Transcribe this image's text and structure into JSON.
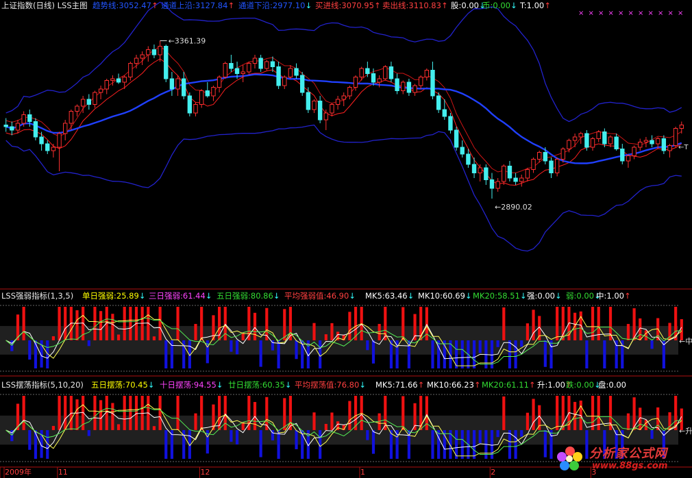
{
  "main_header": {
    "title": "上证指数(日线) LSS主图",
    "items": [
      {
        "label": "趋势线:",
        "value": "3052.47",
        "arrow": "↑",
        "color": "#2255ff"
      },
      {
        "label": "通道上沿:",
        "value": "3127.84",
        "arrow": "↑",
        "color": "#2255ff"
      },
      {
        "label": "通道下沿:",
        "value": "2977.10",
        "arrow": "↓",
        "color": "#2255ff"
      },
      {
        "label": "买进线:",
        "value": "3070.95",
        "arrow": "↑",
        "color": "#ff4040"
      },
      {
        "label": "卖出线:",
        "value": "3110.83",
        "arrow": "↑",
        "color": "#ff4040"
      },
      {
        "label": "股:",
        "value": "0.00",
        "arrow": "↓",
        "color": "#ffffff"
      },
      {
        "label": "币:",
        "value": "0.00",
        "arrow": "↓",
        "color": "#33dd33"
      },
      {
        "label": "T:",
        "value": "1.00",
        "arrow": "↑",
        "color": "#ffffff"
      }
    ],
    "high_label": "3361.39",
    "low_label": "2890.02",
    "t_marker": "T"
  },
  "strength_header": {
    "title": "LSS强弱指标(1,3,5)",
    "items": [
      {
        "label": "单日强弱:",
        "value": "25.89",
        "arrow": "↓",
        "color": "#ffff00"
      },
      {
        "label": "三日强弱:",
        "value": "61.44",
        "arrow": "↓",
        "color": "#ff44ff"
      },
      {
        "label": "五日强弱:",
        "value": "80.86",
        "arrow": "↓",
        "color": "#33dd33"
      },
      {
        "label": "平均强弱值:",
        "value": "46.90",
        "arrow": "↓",
        "color": "#ff4040"
      },
      {
        "label": "MK5:",
        "value": "63.46",
        "arrow": "↓",
        "color": "#ffffff"
      },
      {
        "label": "MK10:",
        "value": "60.69",
        "arrow": "↓",
        "color": "#ffffff"
      },
      {
        "label": "MK20:",
        "value": "58.51",
        "arrow": "↓",
        "color": "#33dd33"
      },
      {
        "label": "强:",
        "value": "0.00",
        "arrow": "↓",
        "color": "#ffffff"
      },
      {
        "label": "弱:",
        "value": "0.00",
        "arrow": "↓",
        "color": "#33dd33"
      },
      {
        "label": "中:",
        "value": "1.00",
        "arrow": "↑",
        "color": "#ffffff"
      }
    ],
    "marker": "中"
  },
  "swing_header": {
    "title": "LSS摆荡指标(5,10,20)",
    "items": [
      {
        "label": "五日摆荡:",
        "value": "70.45",
        "arrow": "↓",
        "color": "#ffff00"
      },
      {
        "label": "十日摆荡:",
        "value": "94.55",
        "arrow": "↓",
        "color": "#ff44ff"
      },
      {
        "label": "廿日摆荡:",
        "value": "60.35",
        "arrow": "↓",
        "color": "#33dd33"
      },
      {
        "label": "平均摆荡值:",
        "value": "76.80",
        "arrow": "↓",
        "color": "#ff4040"
      },
      {
        "label": "MK5:",
        "value": "71.66",
        "arrow": "↑",
        "color": "#ffffff"
      },
      {
        "label": "MK10:",
        "value": "66.23",
        "arrow": "↑",
        "color": "#ffffff"
      },
      {
        "label": "MK20:",
        "value": "61.11",
        "arrow": "↑",
        "color": "#33dd33"
      },
      {
        "label": "升:",
        "value": "1.00",
        "arrow": "↑",
        "color": "#ffffff"
      },
      {
        "label": "跌:",
        "value": "0.00",
        "arrow": "↓",
        "color": "#33dd33"
      },
      {
        "label": "盘:",
        "value": "0.00",
        "arrow": "",
        "color": "#ffffff"
      }
    ],
    "marker": "升"
  },
  "x_axis": {
    "labels": [
      {
        "text": "2009年",
        "bar": 0
      },
      {
        "text": "11",
        "bar": 9
      },
      {
        "text": "12",
        "bar": 33
      },
      {
        "text": "1",
        "bar": 60
      },
      {
        "text": "2",
        "bar": 82
      },
      {
        "text": "3",
        "bar": 99
      }
    ]
  },
  "watermark": {
    "cn": "分析家公式网",
    "url": "www.88gs.com"
  },
  "colors": {
    "up": "#ff3030",
    "down": "#44eeee",
    "trend": "#2040ff",
    "channel": "#2222cc",
    "buy": "#ff2020",
    "sell": "#cc1515",
    "frame": "#b01010",
    "bar_up": "#ee1111",
    "bar_dn": "#1111dd",
    "band": "#202020"
  },
  "chart_data": {
    "type": "candlestick",
    "ylim": [
      2820,
      3420
    ],
    "ohlc": [
      [
        3115,
        3135,
        3095,
        3110
      ],
      [
        3110,
        3125,
        3085,
        3100
      ],
      [
        3100,
        3130,
        3090,
        3120
      ],
      [
        3120,
        3155,
        3110,
        3145
      ],
      [
        3145,
        3160,
        3110,
        3125
      ],
      [
        3125,
        3135,
        3070,
        3080
      ],
      [
        3080,
        3095,
        3040,
        3060
      ],
      [
        3060,
        3070,
        3030,
        3040
      ],
      [
        3040,
        3060,
        3020,
        3050
      ],
      [
        3050,
        3095,
        2980,
        3090
      ],
      [
        3090,
        3130,
        3070,
        3120
      ],
      [
        3120,
        3160,
        3100,
        3155
      ],
      [
        3155,
        3175,
        3140,
        3170
      ],
      [
        3170,
        3200,
        3150,
        3190
      ],
      [
        3190,
        3205,
        3160,
        3175
      ],
      [
        3175,
        3215,
        3165,
        3210
      ],
      [
        3210,
        3230,
        3190,
        3220
      ],
      [
        3220,
        3250,
        3205,
        3245
      ],
      [
        3245,
        3260,
        3230,
        3250
      ],
      [
        3250,
        3265,
        3235,
        3240
      ],
      [
        3240,
        3260,
        3220,
        3255
      ],
      [
        3255,
        3300,
        3245,
        3295
      ],
      [
        3295,
        3320,
        3280,
        3310
      ],
      [
        3310,
        3330,
        3290,
        3320
      ],
      [
        3320,
        3345,
        3300,
        3335
      ],
      [
        3335,
        3350,
        3310,
        3320
      ],
      [
        3320,
        3361,
        3300,
        3345
      ],
      [
        3345,
        3350,
        3240,
        3250
      ],
      [
        3250,
        3270,
        3200,
        3220
      ],
      [
        3220,
        3260,
        3200,
        3250
      ],
      [
        3250,
        3270,
        3190,
        3200
      ],
      [
        3200,
        3210,
        3140,
        3150
      ],
      [
        3150,
        3180,
        3140,
        3175
      ],
      [
        3175,
        3220,
        3165,
        3215
      ],
      [
        3215,
        3240,
        3195,
        3200
      ],
      [
        3200,
        3230,
        3185,
        3225
      ],
      [
        3225,
        3260,
        3210,
        3255
      ],
      [
        3255,
        3300,
        3250,
        3295
      ],
      [
        3295,
        3320,
        3270,
        3280
      ],
      [
        3280,
        3300,
        3250,
        3265
      ],
      [
        3265,
        3290,
        3240,
        3270
      ],
      [
        3270,
        3300,
        3265,
        3295
      ],
      [
        3295,
        3320,
        3280,
        3310
      ],
      [
        3310,
        3320,
        3270,
        3280
      ],
      [
        3280,
        3305,
        3275,
        3300
      ],
      [
        3300,
        3315,
        3270,
        3285
      ],
      [
        3285,
        3300,
        3220,
        3230
      ],
      [
        3230,
        3260,
        3220,
        3255
      ],
      [
        3255,
        3290,
        3250,
        3280
      ],
      [
        3280,
        3295,
        3250,
        3260
      ],
      [
        3260,
        3270,
        3200,
        3210
      ],
      [
        3210,
        3225,
        3150,
        3160
      ],
      [
        3160,
        3190,
        3150,
        3185
      ],
      [
        3185,
        3200,
        3120,
        3130
      ],
      [
        3130,
        3160,
        3100,
        3150
      ],
      [
        3150,
        3180,
        3140,
        3175
      ],
      [
        3175,
        3200,
        3160,
        3190
      ],
      [
        3190,
        3210,
        3170,
        3200
      ],
      [
        3200,
        3230,
        3190,
        3225
      ],
      [
        3225,
        3260,
        3215,
        3255
      ],
      [
        3255,
        3285,
        3245,
        3280
      ],
      [
        3280,
        3300,
        3255,
        3265
      ],
      [
        3265,
        3280,
        3230,
        3240
      ],
      [
        3240,
        3260,
        3225,
        3250
      ],
      [
        3250,
        3290,
        3245,
        3285
      ],
      [
        3285,
        3300,
        3240,
        3250
      ],
      [
        3250,
        3265,
        3205,
        3215
      ],
      [
        3215,
        3245,
        3205,
        3240
      ],
      [
        3240,
        3250,
        3200,
        3210
      ],
      [
        3210,
        3235,
        3200,
        3230
      ],
      [
        3230,
        3260,
        3220,
        3255
      ],
      [
        3255,
        3280,
        3245,
        3275
      ],
      [
        3275,
        3300,
        3190,
        3200
      ],
      [
        3200,
        3210,
        3150,
        3160
      ],
      [
        3160,
        3190,
        3130,
        3140
      ],
      [
        3140,
        3150,
        3090,
        3100
      ],
      [
        3100,
        3110,
        3040,
        3050
      ],
      [
        3050,
        3070,
        3020,
        3030
      ],
      [
        3030,
        3045,
        2990,
        3000
      ],
      [
        3000,
        3020,
        2960,
        2975
      ],
      [
        2975,
        3000,
        2950,
        2990
      ],
      [
        2990,
        3000,
        2940,
        2955
      ],
      [
        2955,
        2975,
        2900,
        2930
      ],
      [
        2930,
        2960,
        2920,
        2950
      ],
      [
        2950,
        3000,
        2940,
        2995
      ],
      [
        2995,
        3010,
        2950,
        2960
      ],
      [
        2960,
        2975,
        2940,
        2950
      ],
      [
        2950,
        2970,
        2935,
        2960
      ],
      [
        2960,
        2990,
        2950,
        2985
      ],
      [
        2985,
        3020,
        2975,
        3015
      ],
      [
        3015,
        3040,
        3005,
        3035
      ],
      [
        3035,
        3050,
        3000,
        3010
      ],
      [
        3010,
        3020,
        2960,
        2975
      ],
      [
        2975,
        3020,
        2965,
        3015
      ],
      [
        3015,
        3050,
        3005,
        3045
      ],
      [
        3045,
        3075,
        3035,
        3070
      ],
      [
        3070,
        3090,
        3050,
        3080
      ],
      [
        3080,
        3095,
        3060,
        3090
      ],
      [
        3090,
        3100,
        3040,
        3050
      ],
      [
        3050,
        3080,
        3040,
        3075
      ],
      [
        3075,
        3100,
        3065,
        3095
      ],
      [
        3095,
        3105,
        3050,
        3060
      ],
      [
        3060,
        3085,
        3050,
        3080
      ],
      [
        3080,
        3090,
        3040,
        3045
      ],
      [
        3045,
        3060,
        3000,
        3010
      ],
      [
        3010,
        3030,
        2990,
        3025
      ],
      [
        3025,
        3055,
        3015,
        3050
      ],
      [
        3050,
        3075,
        3040,
        3065
      ],
      [
        3065,
        3080,
        3050,
        3070
      ],
      [
        3070,
        3085,
        3050,
        3060
      ],
      [
        3060,
        3080,
        3045,
        3075
      ],
      [
        3075,
        3085,
        3030,
        3040
      ],
      [
        3040,
        3060,
        3020,
        3055
      ],
      [
        3055,
        3110,
        3050,
        3105
      ],
      [
        3105,
        3125,
        3090,
        3115
      ]
    ]
  }
}
